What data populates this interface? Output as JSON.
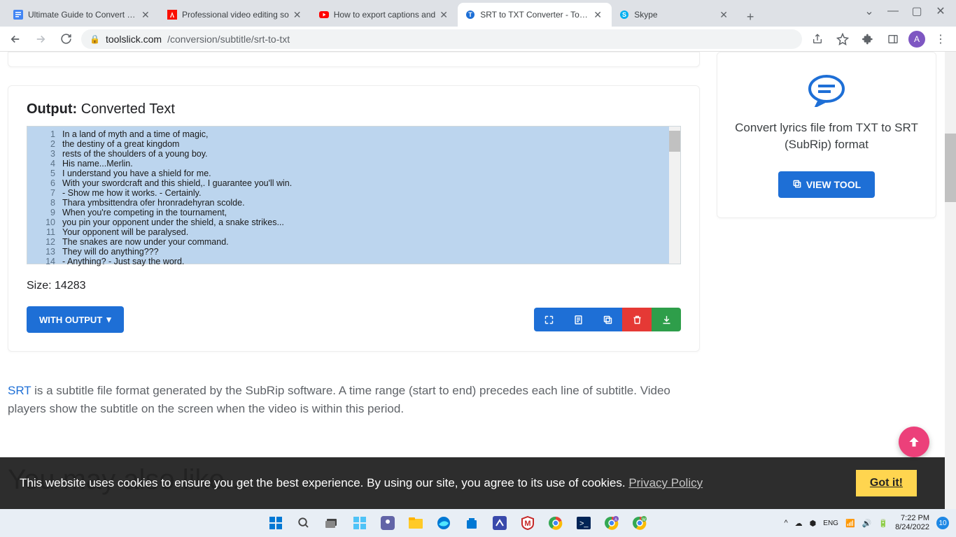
{
  "window": {
    "profile_initial": "A"
  },
  "tabs": [
    {
      "title": "Ultimate Guide to Convert SR",
      "favicon_color": "#4285f4"
    },
    {
      "title": "Professional video editing so",
      "favicon_color": "#fa0f00"
    },
    {
      "title": "How to export captions and",
      "favicon_color": "#ff0000"
    },
    {
      "title": "SRT to TXT Converter - Tool S",
      "favicon_color": "#1e6fd6",
      "active": true
    },
    {
      "title": "Skype",
      "favicon_color": "#00aff0"
    }
  ],
  "address": {
    "host": "toolslick.com",
    "path": "/conversion/subtitle/srt-to-txt"
  },
  "output": {
    "head_bold": "Output:",
    "head_rest": " Converted Text",
    "lines": [
      "In a land of myth and a time of magic,",
      "the destiny of a great kingdom",
      "rests of the shoulders of a young boy.",
      "His name...Merlin.",
      "I understand you have a shield for me.",
      "With your swordcraft and this shield,. I guarantee you'll win.",
      "- Show me how it works. - Certainly.",
      "Thara ymbsittendra ofer hronradehyran scolde.",
      "When you're competing in the tournament,",
      "you pin your opponent under the shield, a snake strikes...",
      "Your opponent will be paralysed.",
      "The snakes are now under your command.",
      "They will do anything???",
      "- Anything? - Just say the word."
    ],
    "size_label": "Size: ",
    "size_value": "14283",
    "with_output_label": "WITH OUTPUT"
  },
  "desc": {
    "link": "SRT",
    "text": " is a subtitle file format generated by the SubRip software. A time range (start to end) precedes each line of subtitle. Video players show the subtitle on the screen when the video is within this period."
  },
  "also_like": "You may also like...",
  "sidebar": {
    "text": "Convert lyrics file from TXT to SRT (SubRip) format",
    "button": "VIEW TOOL"
  },
  "cookie": {
    "text": "This website uses cookies to ensure you get the best experience. By using our site, you agree to its use of cookies. ",
    "link": "Privacy Policy",
    "button": "Got it!"
  },
  "tray": {
    "time": "7:22 PM",
    "date": "8/24/2022",
    "badge": "10"
  }
}
